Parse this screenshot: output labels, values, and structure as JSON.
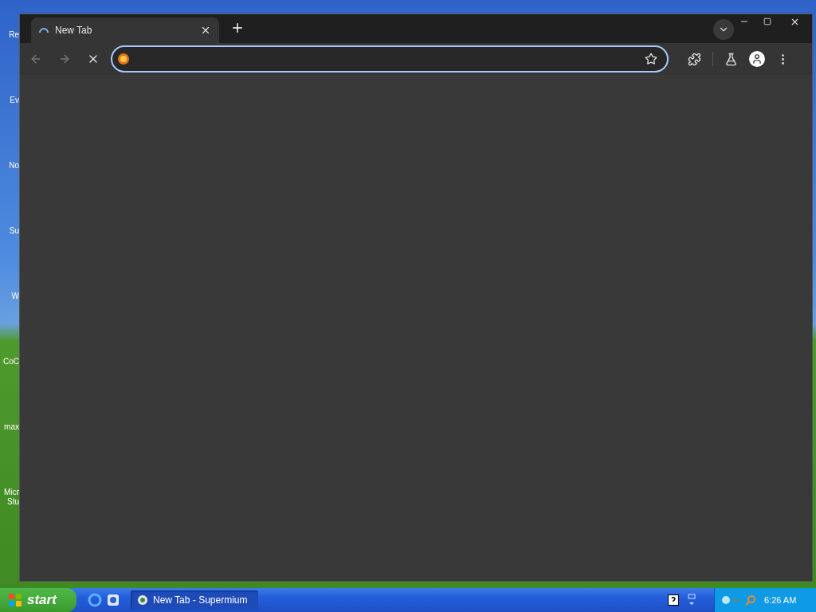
{
  "desktop_icons": [
    {
      "label": "Re"
    },
    {
      "label": "Ev"
    },
    {
      "label": "No"
    },
    {
      "label": "Su"
    },
    {
      "label": "W"
    },
    {
      "label": "CoC"
    },
    {
      "label": "max"
    },
    {
      "label": "Micr\nStu"
    }
  ],
  "browser": {
    "tabs": [
      {
        "title": "New Tab",
        "selected": true,
        "loading": true
      }
    ],
    "address_bar": {
      "focused": true
    }
  },
  "taskbar": {
    "start_label": "start",
    "tasks": [
      {
        "label": "New Tab - Supermium",
        "selected": true
      }
    ],
    "clock": "6:26 AM"
  }
}
